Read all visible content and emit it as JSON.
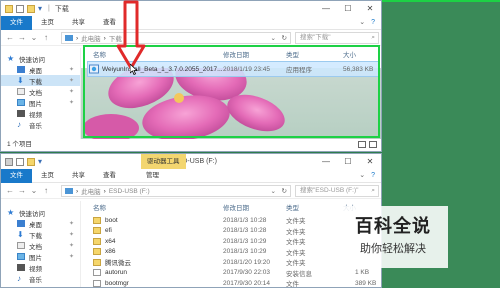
{
  "window1": {
    "title": "下载",
    "ribbon_tabs": [
      "文件",
      "主页",
      "共享",
      "查看"
    ],
    "breadcrumb": [
      "此电脑",
      "下载"
    ],
    "search_placeholder": "搜索\"下载\"",
    "columns": {
      "name": "名称",
      "date": "修改日期",
      "type": "类型",
      "size": "大小"
    },
    "file": {
      "name": "WeiyunInstall_Beta_1_3.7.0.2055_2017...",
      "date": "2018/1/19 23:45",
      "type": "应用程序",
      "size": "56,383 KB"
    },
    "nav": [
      {
        "label": "快速访问",
        "icon": "star-icon"
      },
      {
        "label": "桌面",
        "icon": "desktop-icon",
        "pinned": true
      },
      {
        "label": "下载",
        "icon": "download-icon",
        "pinned": true,
        "selected": true
      },
      {
        "label": "文档",
        "icon": "document-icon",
        "pinned": true
      },
      {
        "label": "图片",
        "icon": "picture-icon",
        "pinned": true
      },
      {
        "label": "视频",
        "icon": "video-icon"
      },
      {
        "label": "音乐",
        "icon": "music-icon"
      }
    ],
    "status": "1 个项目"
  },
  "window2": {
    "title": "ESD-USB (F:)",
    "contextual_tab": "驱动器工具",
    "ribbon_tabs": [
      "文件",
      "主页",
      "共享",
      "查看"
    ],
    "ribbon_manage": "管理",
    "breadcrumb": [
      "此电脑",
      "ESD-USB (F:)"
    ],
    "search_placeholder": "搜索\"ESD-USB (F:)\"",
    "columns": {
      "name": "名称",
      "date": "修改日期",
      "type": "类型",
      "size": "大小"
    },
    "nav": [
      {
        "label": "快速访问",
        "icon": "star-icon"
      },
      {
        "label": "桌面",
        "icon": "desktop-icon",
        "pinned": true
      },
      {
        "label": "下载",
        "icon": "download-icon",
        "pinned": true
      },
      {
        "label": "文档",
        "icon": "document-icon",
        "pinned": true
      },
      {
        "label": "图片",
        "icon": "picture-icon",
        "pinned": true
      },
      {
        "label": "视频",
        "icon": "video-icon"
      },
      {
        "label": "音乐",
        "icon": "music-icon"
      }
    ],
    "files": [
      {
        "name": "boot",
        "date": "2018/1/3 10:28",
        "type": "文件夹",
        "size": "",
        "kind": "folder"
      },
      {
        "name": "efi",
        "date": "2018/1/3 10:28",
        "type": "文件夹",
        "size": "",
        "kind": "folder"
      },
      {
        "name": "x64",
        "date": "2018/1/3 10:29",
        "type": "文件夹",
        "size": "",
        "kind": "folder"
      },
      {
        "name": "x86",
        "date": "2018/1/3 10:29",
        "type": "文件夹",
        "size": "",
        "kind": "folder"
      },
      {
        "name": "腾讯微云",
        "date": "2018/1/20 19:20",
        "type": "文件夹",
        "size": "",
        "kind": "folder"
      },
      {
        "name": "autorun",
        "date": "2017/9/30 22:03",
        "type": "安装信息",
        "size": "1 KB",
        "kind": "file"
      },
      {
        "name": "bootmgr",
        "date": "2017/9/30 20:14",
        "type": "文件",
        "size": "389 KB",
        "kind": "file"
      }
    ]
  },
  "watermark": {
    "title": "百科全说",
    "subtitle": "助你轻松解决"
  },
  "colors": {
    "highlight": "#1dd145",
    "arrow": "#e02a2a",
    "accent": "#1979ca"
  }
}
